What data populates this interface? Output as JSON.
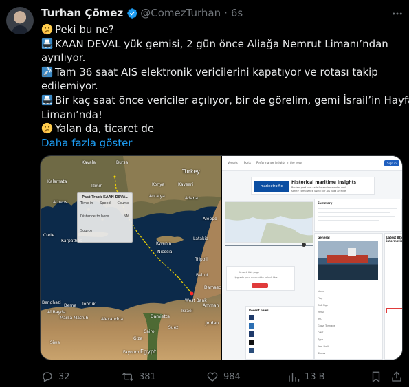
{
  "author": {
    "name": "Turhan Çömez",
    "handle": "@ComezTurhan",
    "separator": "·",
    "time": "6s"
  },
  "tweet": {
    "lines": [
      "Peki bu ne?",
      "KAAN DEVAL yük gemisi, 2 gün önce Aliağa Nemrut Limanı’ndan",
      "ayrılıyor.",
      "Tam 36 saat AIS elektronik vericilerini kapatıyor ve rotası takip",
      "edilemiyor.",
      "Bir kaç saat önce vericiler açılıyor, bir de görelim, gemi İsrail’in Hayfa",
      "Limanı’nda!",
      "Yalan da, ticaret de"
    ],
    "show_more": "Daha fazla göster"
  },
  "map": {
    "labels": [
      "Turkey",
      "Athens",
      "Izmir",
      "Antalya",
      "Adana",
      "Kyrenia",
      "Nicosia",
      "Latakia",
      "Tripoli",
      "Beirut",
      "West Bank",
      "Israel",
      "Alexandria",
      "Cairo",
      "Giza",
      "Suez",
      "Egypt",
      "Crete",
      "Benghazi",
      "Derna",
      "Marsa Matruh",
      "Damietta",
      "Karpathos",
      "Kalamata",
      "Kavala",
      "Bursa",
      "Konya",
      "Kayseri",
      "Aleppo",
      "Damascus",
      "Jordan",
      "Amman",
      "Siwa",
      "Al Bayda",
      "Tobruk",
      "Fayoum"
    ],
    "track_box": {
      "title": "Past Track KAAN DEVAL",
      "headers": [
        "Time in",
        "Speed",
        "Course"
      ],
      "distance": "Distance to here",
      "nm": "NM",
      "source": "Source"
    }
  },
  "site": {
    "nav": [
      "Vessels",
      "Ports",
      "Performance insights",
      "In the news"
    ],
    "button": "Sign in",
    "banner_logo": "marinetraffic",
    "banner_title": "Historical maritime insights",
    "banner_sub": "Review past port calls for environmental and safety compliance using our AIS data archive.",
    "summary": "Summary",
    "general": "General",
    "latest": "Latest AIS information",
    "general_rows": [
      "Name",
      "Flag",
      "Call Sign",
      "MMSI",
      "IMO",
      "Gross Tonnage",
      "DWT",
      "Type",
      "Year Built",
      "Status"
    ],
    "recent": "Recent news",
    "login_prompt": "Unlock this page",
    "login_sub": "Upgrade your account to unlock this"
  },
  "stats": {
    "replies": "32",
    "reposts": "381",
    "likes": "984",
    "views": "13 B"
  },
  "colors": {
    "link": "#1d9bf0",
    "muted": "#71767b",
    "verified": "#1d9bf0",
    "track": "#f5d800"
  }
}
